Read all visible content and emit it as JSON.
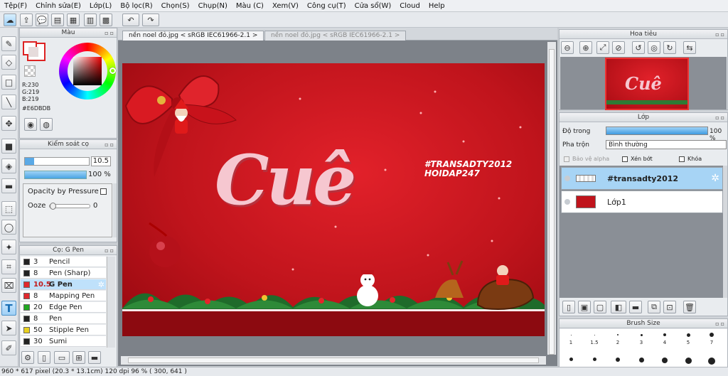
{
  "menu": [
    "Tệp(F)",
    "Chỉnh sửa(E)",
    "Lớp(L)",
    "Bộ lọc(R)",
    "Chọn(S)",
    "Chụp(N)",
    "Màu (C)",
    "Xem(V)",
    "Công cụ(T)",
    "Cửa sổ(W)",
    "Cloud",
    "Help"
  ],
  "color_panel": {
    "title": "Màu",
    "r": "R:230",
    "g": "G:219",
    "b": "B:219",
    "hex": "#E6DBDB",
    "main_color": "#e6dbdb"
  },
  "brush_control": {
    "title": "Kiểm soát cọ",
    "size_value": "10.5",
    "opacity_value": "100 %",
    "opacity_by_pressure": "Opacity by Pressure",
    "ooze_label": "Ooze",
    "ooze_value": "0"
  },
  "pen_list": {
    "title": "Cọ: G Pen",
    "items": [
      {
        "size": "3",
        "name": "Pencil",
        "color": "#222222"
      },
      {
        "size": "8",
        "name": "Pen (Sharp)",
        "color": "#222222"
      },
      {
        "size": "10.5",
        "name": "G Pen",
        "color": "#e0282d"
      },
      {
        "size": "8",
        "name": "Mapping Pen",
        "color": "#e0282d"
      },
      {
        "size": "20",
        "name": "Edge Pen",
        "color": "#22a822"
      },
      {
        "size": "8",
        "name": "Pen",
        "color": "#222222"
      },
      {
        "size": "50",
        "name": "Stipple Pen",
        "color": "#e8d020"
      },
      {
        "size": "30",
        "name": "Sumi",
        "color": "#222222"
      }
    ]
  },
  "tabs": {
    "active": "nền noel đỏ.jpg < sRGB IEC61966-2.1 >",
    "inactive": "nền noel đỏ.jpg < sRGB IEC61966-2.1 >"
  },
  "canvas": {
    "logo": "Cuê",
    "line1": "#TRANSADTY2012",
    "line2": "HOIDAP247"
  },
  "navigator": {
    "title": "Hoa tiêu"
  },
  "layers": {
    "title": "Lớp",
    "opacity_label": "Độ trong",
    "opacity_value": "100 %",
    "opacity_fraction": 1.0,
    "blend_label": "Pha trộn",
    "blend_value": "Bình thường",
    "protect_alpha": "Bảo vệ alpha",
    "clip": "Xén bớt",
    "lock": "Khóa",
    "items": [
      {
        "name": "#transadty2012",
        "selected": true
      },
      {
        "name": "Lớp1",
        "selected": false
      }
    ]
  },
  "brush_size": {
    "title": "Brush Size",
    "sizes": [
      "1",
      "1.5",
      "2",
      "3",
      "4",
      "5",
      "7"
    ]
  },
  "status": {
    "text": "960 * 617 pixel  (20.3 * 13.1cm)  120 dpi  96 %  ( 300, 641 )"
  }
}
